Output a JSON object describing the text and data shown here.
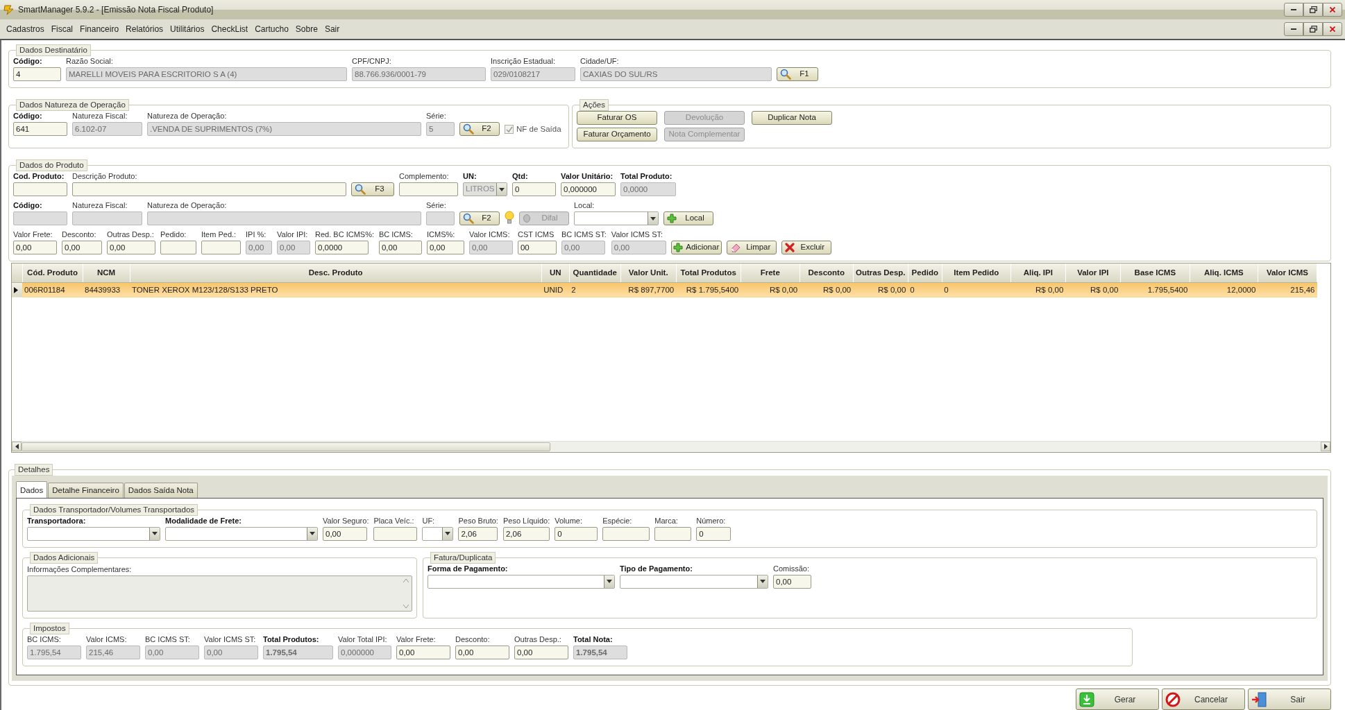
{
  "window": {
    "title": "SmartManager 5.9.2 - [Emissão Nota Fiscal Produto]"
  },
  "menu": [
    "Cadastros",
    "Fiscal",
    "Financeiro",
    "Relatórios",
    "Utilitários",
    "CheckList",
    "Cartucho",
    "Sobre",
    "Sair"
  ],
  "destinatario": {
    "title": "Dados Destinatário",
    "items": [
      {
        "kind": "field",
        "label": "Código:",
        "bold": true,
        "value": "4",
        "disabled": false
      },
      {
        "kind": "field",
        "label": "Razão Social:",
        "bold": false,
        "value": "MARELLI MOVEIS PARA ESCRITORIO S A (4)",
        "disabled": true
      },
      {
        "kind": "field",
        "label": "CPF/CNPJ:",
        "bold": false,
        "value": "88.766.936/0001-79",
        "disabled": true
      },
      {
        "kind": "field",
        "label": "Inscrição Estadual:",
        "bold": false,
        "value": "029/0108217",
        "disabled": true
      },
      {
        "kind": "field",
        "label": "Cidade/UF:",
        "bold": false,
        "value": "CAXIAS DO SUL/RS",
        "disabled": true
      },
      {
        "kind": "lookup",
        "label": "F1",
        "disabled": false
      }
    ]
  },
  "natureza": {
    "title": "Dados Natureza de Operação",
    "items": [
      {
        "kind": "field",
        "label": "Código:",
        "bold": true,
        "value": "641",
        "disabled": false
      },
      {
        "kind": "field",
        "label": "Natureza Fiscal:",
        "bold": false,
        "value": "6.102-07",
        "disabled": true
      },
      {
        "kind": "field",
        "label": "Natureza de Operação:",
        "bold": false,
        "value": ".VENDA DE SUPRIMENTOS (7%)",
        "disabled": true
      },
      {
        "kind": "field",
        "label": "Série:",
        "bold": false,
        "value": "5",
        "disabled": true
      },
      {
        "kind": "lookup",
        "label": "F2",
        "disabled": false
      },
      {
        "kind": "checkbox",
        "label": "NF de Saída",
        "checked": true,
        "disabled": true
      }
    ]
  },
  "acoes": {
    "title": "Ações",
    "buttons": [
      {
        "label": "Faturar OS",
        "disabled": false
      },
      {
        "label": "Devolução",
        "disabled": true
      },
      {
        "label": "Duplicar Nota",
        "disabled": false
      },
      {
        "label": "Faturar Orçamento",
        "disabled": false
      },
      {
        "label": "Nota Complementar",
        "disabled": true
      }
    ]
  },
  "produto": {
    "title": "Dados do Produto",
    "lines": [
      {
        "items": [
          {
            "kind": "field",
            "label": "Cod. Produto:",
            "bold": true,
            "disabled": false
          },
          {
            "kind": "field",
            "label": "Descrição Produto:",
            "bold": false,
            "disabled": false
          },
          {
            "kind": "lookup",
            "label": "F3",
            "disabled": false
          },
          {
            "kind": "field",
            "label": "Complemento:",
            "bold": false,
            "disabled": false
          },
          {
            "kind": "select",
            "label": "UN:",
            "bold": true,
            "value": "LITROS",
            "disabled": true
          },
          {
            "kind": "field",
            "label": "Qtd:",
            "bold": true,
            "value": "0",
            "disabled": false
          },
          {
            "kind": "field",
            "label": "Valor Unitário:",
            "bold": true,
            "value": "0,000000",
            "disabled": false
          },
          {
            "kind": "field",
            "label": "Total Produto:",
            "bold": true,
            "value": "0,0000",
            "disabled": true
          }
        ]
      },
      {
        "items": [
          {
            "kind": "field",
            "label": "Código:",
            "bold": true,
            "disabled": true
          },
          {
            "kind": "field",
            "label": "Natureza Fiscal:",
            "bold": false,
            "disabled": true
          },
          {
            "kind": "field",
            "label": "Natureza de Operação:",
            "bold": false,
            "disabled": true
          },
          {
            "kind": "field",
            "label": "Série:",
            "bold": false,
            "disabled": true
          },
          {
            "kind": "lookup",
            "label": "F2",
            "disabled": false
          },
          {
            "kind": "hint"
          },
          {
            "kind": "difal",
            "label": "Difal",
            "disabled": true
          },
          {
            "kind": "select",
            "label": "Local:",
            "bold": false,
            "disabled": false
          },
          {
            "kind": "add",
            "label": "Local",
            "disabled": false
          }
        ]
      },
      {
        "items": [
          {
            "kind": "field",
            "label": "Valor Frete:",
            "bold": false,
            "value": "0,00",
            "disabled": false
          },
          {
            "kind": "field",
            "label": "Desconto:",
            "bold": false,
            "value": "0,00",
            "disabled": false
          },
          {
            "kind": "field",
            "label": "Outras Desp.:",
            "bold": false,
            "value": "0,00",
            "disabled": false
          },
          {
            "kind": "field",
            "label": "Pedido:",
            "bold": false,
            "disabled": false
          },
          {
            "kind": "field",
            "label": "Item Ped.:",
            "bold": false,
            "disabled": false
          },
          {
            "kind": "field",
            "label": "IPI %:",
            "bold": false,
            "value": "0,00",
            "disabled": true
          },
          {
            "kind": "field",
            "label": "Valor IPI:",
            "bold": false,
            "value": "0,00",
            "disabled": true
          },
          {
            "kind": "field",
            "label": "Red. BC ICMS%:",
            "bold": false,
            "value": "0,0000",
            "disabled": false
          },
          {
            "kind": "field",
            "label": "BC ICMS:",
            "bold": false,
            "value": "0,00",
            "disabled": false
          },
          {
            "kind": "field",
            "label": "ICMS%:",
            "bold": false,
            "value": "0,00",
            "disabled": false
          },
          {
            "kind": "field",
            "label": "Valor ICMS:",
            "bold": false,
            "value": "0,00",
            "disabled": true
          },
          {
            "kind": "field",
            "label": "CST ICMS",
            "bold": false,
            "value": "00",
            "disabled": false
          },
          {
            "kind": "field",
            "label": "BC ICMS ST:",
            "bold": false,
            "value": "0,00",
            "disabled": true
          },
          {
            "kind": "field",
            "label": "Valor ICMS ST:",
            "bold": false,
            "value": "0,00",
            "disabled": true
          },
          {
            "kind": "add",
            "label": "Adicionar",
            "disabled": false
          },
          {
            "kind": "clear",
            "label": "Limpar",
            "disabled": false
          },
          {
            "kind": "delete",
            "label": "Excluir",
            "disabled": false
          }
        ]
      }
    ]
  },
  "grid": {
    "columns": [
      "Cód. Produto",
      "NCM",
      "Desc. Produto",
      "UN",
      "Quantidade",
      "Valor Unit.",
      "Total Produtos",
      "Frete",
      "Desconto",
      "Outras Desp.",
      "Pedido",
      "Item Pedido",
      "Aliq. IPI",
      "Valor IPI",
      "Base ICMS",
      "Aliq. ICMS",
      "Valor ICMS"
    ],
    "rows": [
      {
        "selected": true,
        "cells": [
          "006R01184",
          "84439933",
          "TONER XEROX M123/128/S133 PRETO",
          "UNID",
          "2",
          "R$ 897,7700",
          "R$ 1.795,5400",
          "R$ 0,00",
          "R$ 0,00",
          "R$ 0,00",
          "0",
          "0",
          "R$ 0,00",
          "R$ 0,00",
          "1.795,5400",
          "12,0000",
          "215,46"
        ]
      }
    ]
  },
  "detalhes": {
    "title": "Detalhes",
    "tabs": [
      {
        "label": "Dados",
        "selected": true
      },
      {
        "label": "Detalhe Financeiro",
        "selected": false
      },
      {
        "label": "Dados Saída Nota",
        "selected": false
      }
    ],
    "transporte": {
      "title": "Dados Transportador/Volumes Transportados",
      "items": [
        {
          "kind": "select",
          "label": "Transportadora:",
          "bold": true,
          "disabled": false
        },
        {
          "kind": "select",
          "label": "Modalidade de Frete:",
          "bold": true,
          "disabled": false
        },
        {
          "kind": "field",
          "label": "Valor Seguro:",
          "bold": false,
          "value": "0,00",
          "disabled": false
        },
        {
          "kind": "field",
          "label": "Placa Veíc.:",
          "bold": false,
          "disabled": false
        },
        {
          "kind": "select",
          "label": "UF:",
          "bold": false,
          "disabled": false
        },
        {
          "kind": "field",
          "label": "Peso Bruto:",
          "bold": false,
          "value": "2,06",
          "disabled": false
        },
        {
          "kind": "field",
          "label": "Peso Líquido:",
          "bold": false,
          "value": "2,06",
          "disabled": false
        },
        {
          "kind": "field",
          "label": "Volume:",
          "bold": false,
          "value": "0",
          "disabled": false
        },
        {
          "kind": "field",
          "label": "Espécie:",
          "bold": false,
          "disabled": false
        },
        {
          "kind": "field",
          "label": "Marca:",
          "bold": false,
          "disabled": false
        },
        {
          "kind": "field",
          "label": "Número:",
          "bold": false,
          "value": "0",
          "disabled": false
        }
      ]
    },
    "adicionais": {
      "title": "Dados Adicionais",
      "label": "Informações Complementares:",
      "disabled": true
    },
    "fatura": {
      "title": "Fatura/Duplicata",
      "items": [
        {
          "kind": "select",
          "label": "Forma de Pagamento:",
          "bold": true,
          "disabled": false
        },
        {
          "kind": "select",
          "label": "Tipo de Pagamento:",
          "bold": true,
          "disabled": false
        },
        {
          "kind": "field",
          "label": "Comissão:",
          "bold": false,
          "value": "0,00",
          "disabled": false
        }
      ]
    },
    "impostos": {
      "title": "Impostos",
      "items": [
        {
          "kind": "field",
          "label": "BC ICMS:",
          "bold": false,
          "value": "1.795,54",
          "value_bold": false,
          "disabled": true
        },
        {
          "kind": "field",
          "label": "Valor ICMS:",
          "bold": false,
          "value": "215,46",
          "value_bold": false,
          "disabled": true
        },
        {
          "kind": "field",
          "label": "BC ICMS ST:",
          "bold": false,
          "value": "0,00",
          "value_bold": false,
          "disabled": true
        },
        {
          "kind": "field",
          "label": "Valor ICMS ST:",
          "bold": false,
          "value": "0,00",
          "value_bold": false,
          "disabled": true
        },
        {
          "kind": "field",
          "label": "Total Produtos:",
          "bold": true,
          "value": "1.795,54",
          "value_bold": true,
          "disabled": true
        },
        {
          "kind": "field",
          "label": "Valor Total IPI:",
          "bold": false,
          "value": "0,000000",
          "value_bold": false,
          "disabled": true
        },
        {
          "kind": "field",
          "label": "Valor Frete:",
          "bold": false,
          "value": "0,00",
          "value_bold": false,
          "disabled": false
        },
        {
          "kind": "field",
          "label": "Desconto:",
          "bold": false,
          "value": "0,00",
          "value_bold": false,
          "disabled": false
        },
        {
          "kind": "field",
          "label": "Outras Desp.:",
          "bold": false,
          "value": "0,00",
          "value_bold": false,
          "disabled": false
        },
        {
          "kind": "field",
          "label": "Total Nota:",
          "bold": true,
          "value": "1.795,54",
          "value_bold": true,
          "disabled": true
        }
      ]
    }
  },
  "footer": [
    {
      "kind": "generate",
      "label": "Gerar"
    },
    {
      "kind": "cancel",
      "label": "Cancelar"
    },
    {
      "kind": "exit",
      "label": "Sair"
    }
  ]
}
